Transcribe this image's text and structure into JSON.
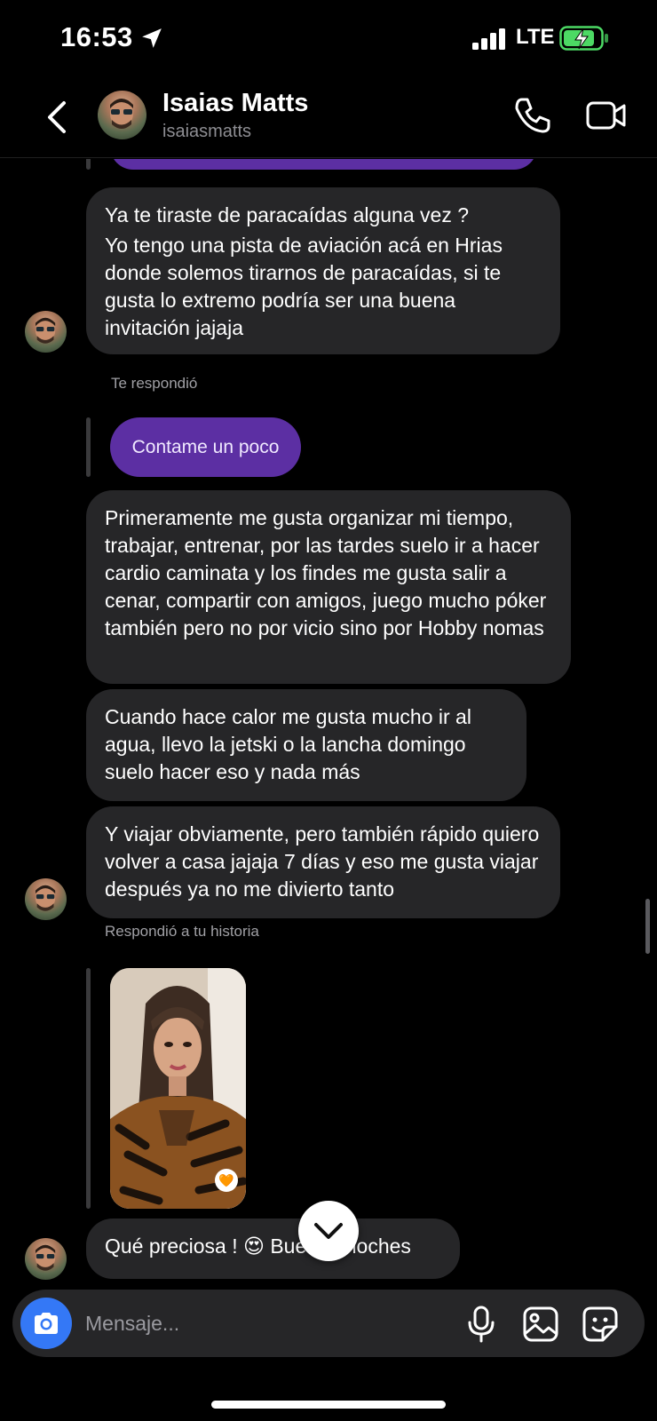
{
  "status_bar": {
    "time": "16:53",
    "network": "LTE"
  },
  "header": {
    "contact_name": "Isaias Matts",
    "contact_handle": "isaiasmatts"
  },
  "messages": {
    "m1": [
      "Ya te tiraste de paracaídas alguna vez ?",
      "Yo tengo una pista de aviación acá en Hrias donde solemos tirarnos de paracaídas, si te gusta lo extremo podría ser una buena invitación jajaja"
    ],
    "reply_meta": "Te respondió",
    "my_reply": "Contame un poco",
    "m2": "Primeramente me gusta organizar mi tiempo, trabajar, entrenar, por las tardes suelo ir a hacer cardio caminata y los findes me gusta salir a cenar, compartir con amigos, juego mucho póker también pero no por vicio sino por Hobby nomas",
    "m3": "Cuando hace calor me gusta mucho ir al agua, llevo la jetski o la lancha domingo suelo hacer eso y nada más",
    "m4": "Y viajar obviamente, pero también rápido quiero volver a casa jajaja 7 días y eso me gusta viajar después ya no me divierto tanto",
    "story_meta": "Respondió a tu historia",
    "story_reaction": "🧡",
    "m5": "Qué preciosa ! 😍 Buenas noches"
  },
  "composer": {
    "placeholder": "Mensaje..."
  },
  "icons": {
    "status": [
      "location-arrow-icon",
      "signal-icon",
      "battery-charging-icon"
    ],
    "header": [
      "back-chevron-icon",
      "phone-icon",
      "video-camera-icon"
    ],
    "composer": [
      "camera-icon",
      "microphone-icon",
      "gallery-icon",
      "sticker-icon"
    ],
    "chat": [
      "chevron-down-icon"
    ]
  },
  "colors": {
    "background": "#000000",
    "incoming_bubble": "#262628",
    "outgoing_bubble": "#5c2fa3",
    "camera_button": "#3478f6",
    "battery_charge": "#4cd964"
  }
}
